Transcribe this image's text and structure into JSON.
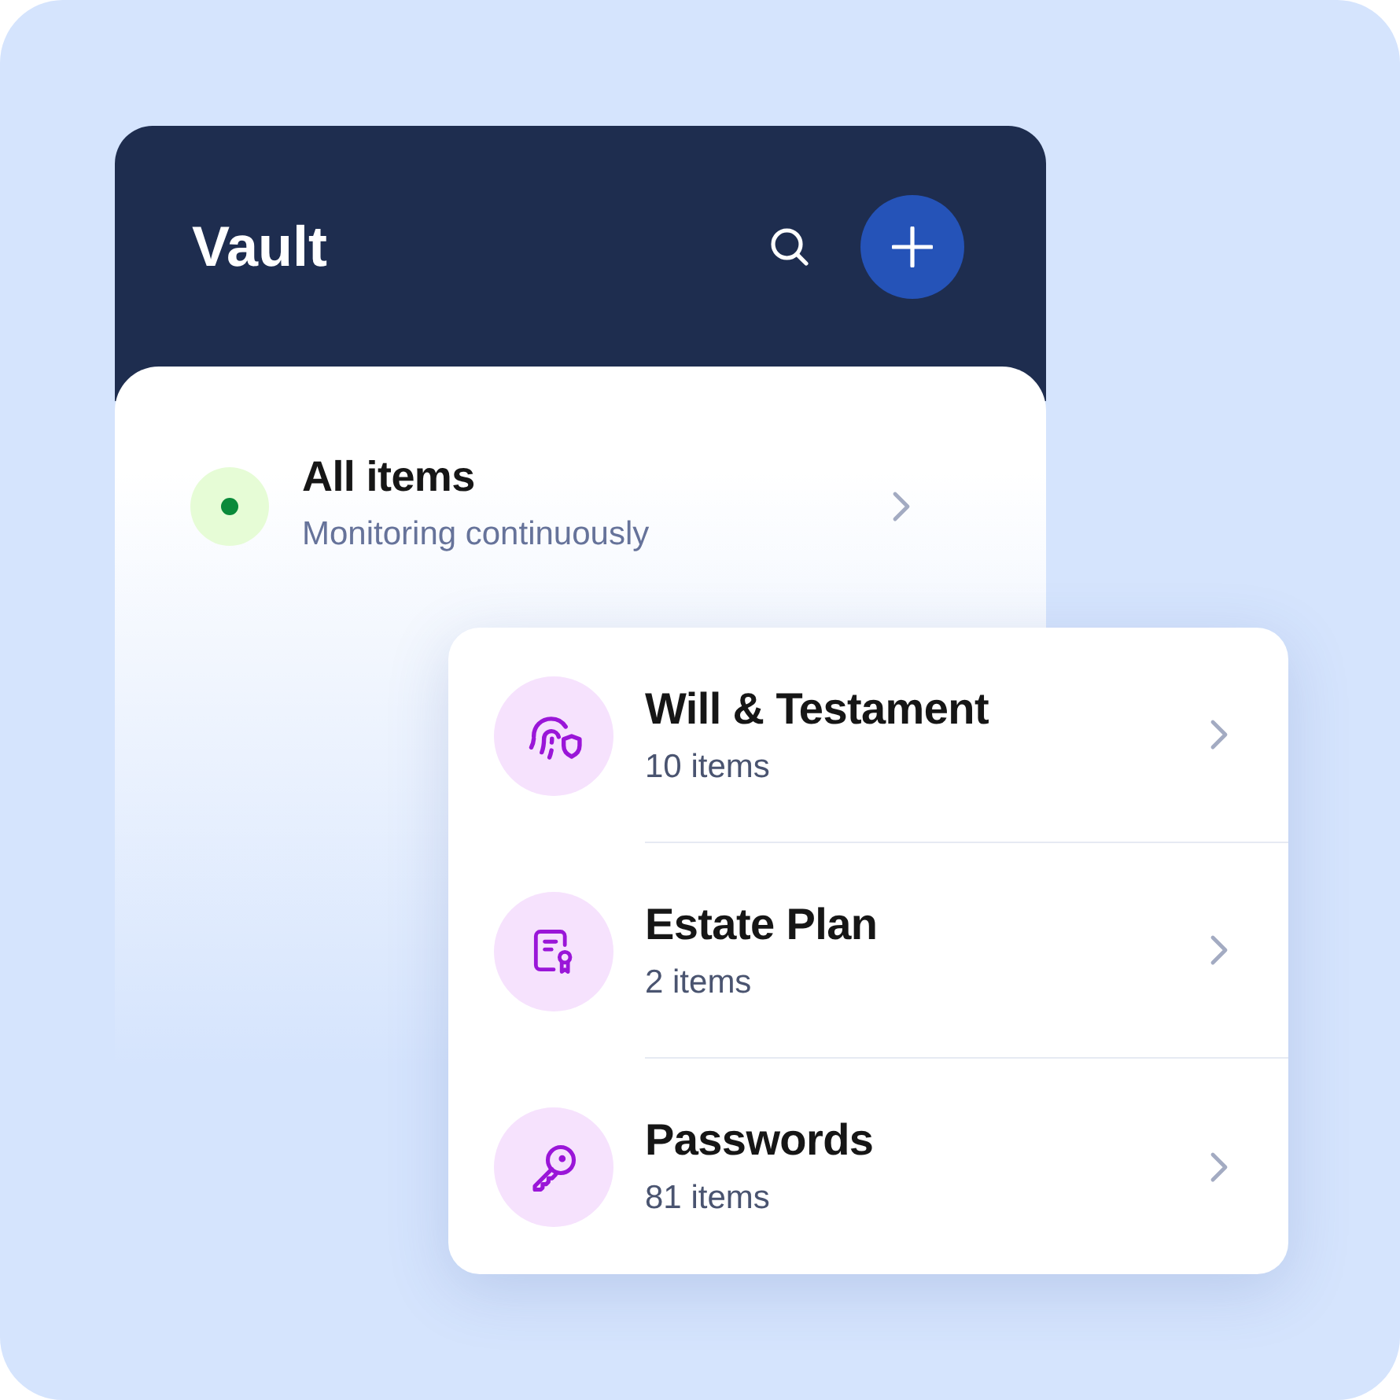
{
  "header": {
    "title": "Vault"
  },
  "summary": {
    "title": "All items",
    "subtitle": "Monitoring continuously"
  },
  "categories": [
    {
      "kind": "fingerprint",
      "title": "Will & Testament",
      "count": "10 items"
    },
    {
      "kind": "certificate",
      "title": "Estate Plan",
      "count": "2 items"
    },
    {
      "kind": "key",
      "title": "Passwords",
      "count": "81 items"
    }
  ]
}
